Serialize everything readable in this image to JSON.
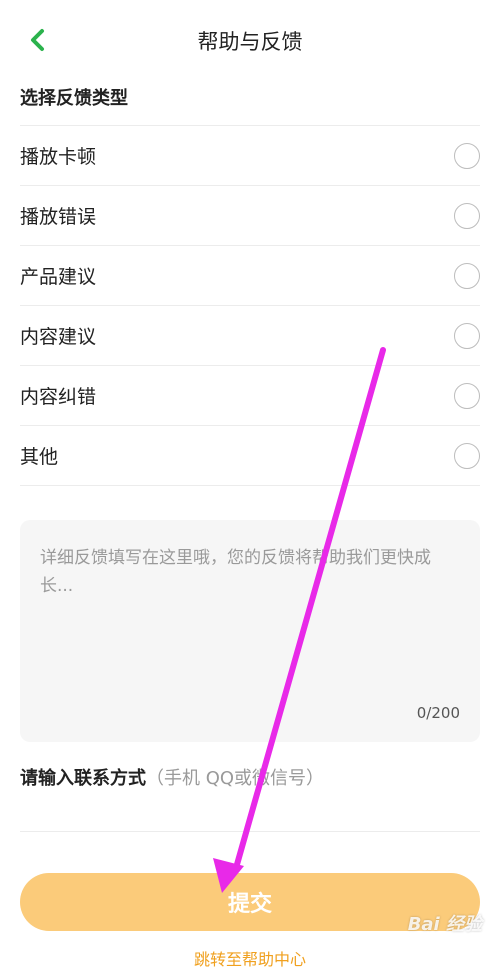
{
  "header": {
    "title": "帮助与反馈",
    "back_icon": "chevron-left-icon",
    "accent_color": "#2bb24c"
  },
  "feedback_type": {
    "section_title": "选择反馈类型",
    "options": [
      {
        "label": "播放卡顿",
        "selected": false
      },
      {
        "label": "播放错误",
        "selected": false
      },
      {
        "label": "产品建议",
        "selected": false
      },
      {
        "label": "内容建议",
        "selected": false
      },
      {
        "label": "内容纠错",
        "selected": false
      },
      {
        "label": "其他",
        "selected": false
      }
    ]
  },
  "detail": {
    "placeholder": "详细反馈填写在这里哦，您的反馈将帮助我们更快成长...",
    "value": "",
    "counter": "0/200"
  },
  "contact": {
    "label": "请输入联系方式",
    "hint": "（手机 QQ或微信号）",
    "value": ""
  },
  "submit": {
    "label": "提交",
    "color": "#fbcb7a"
  },
  "help_link": {
    "label": "跳转至帮助中心",
    "color": "#f0a01e"
  },
  "annotation": {
    "arrow_color": "#e829e8"
  },
  "watermark": {
    "text": "Bai 经验"
  }
}
